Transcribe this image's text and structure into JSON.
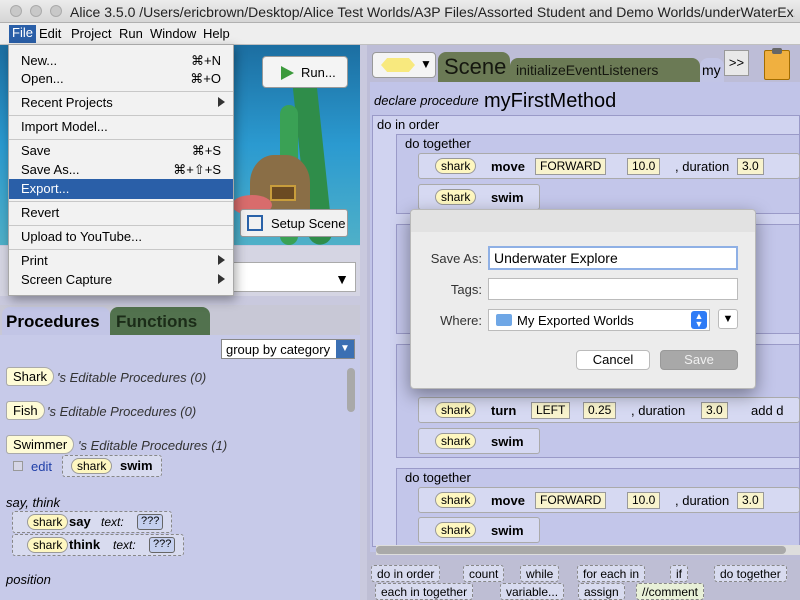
{
  "window": {
    "title": "Alice 3.5.0 /Users/ericbrown/Desktop/Alice Test Worlds/A3P Files/Assorted Student and Demo Worlds/underWaterEx..."
  },
  "menubar": {
    "items": [
      "File",
      "Edit",
      "Project",
      "Run",
      "Window",
      "Help"
    ]
  },
  "file_menu": {
    "items": [
      {
        "label": "New...",
        "shortcut": "⌘+N"
      },
      {
        "label": "Open...",
        "shortcut": "⌘+O"
      },
      {
        "label": "Recent Projects",
        "shortcut": ""
      },
      {
        "label": "Import Model...",
        "shortcut": ""
      },
      {
        "label": "Save",
        "shortcut": "⌘+S"
      },
      {
        "label": "Save As...",
        "shortcut": "⌘+⇧+S"
      },
      {
        "label": "Export...",
        "shortcut": ""
      },
      {
        "label": "Revert",
        "shortcut": ""
      },
      {
        "label": "Upload to YouTube...",
        "shortcut": ""
      },
      {
        "label": "Print",
        "shortcut": ""
      },
      {
        "label": "Screen Capture",
        "shortcut": ""
      }
    ],
    "selected": "Export..."
  },
  "scene": {
    "run_label": "Run...",
    "setup_label": "Setup Scene"
  },
  "left_tabs": {
    "procedures": "Procedures",
    "functions": "Functions"
  },
  "group_select": {
    "value": "group by category"
  },
  "procedures": {
    "shark_type": "Shark",
    "shark_title": "'s Editable Procedures (0)",
    "fish_type": "Fish",
    "fish_title": "'s Editable Procedures (0)",
    "swimmer_type": "Swimmer",
    "swimmer_title": "'s Editable Procedures (1)",
    "edit_label": "edit",
    "shark": "shark",
    "swim": "swim",
    "say_think": "say, think",
    "say": "say",
    "think": "think",
    "text": "text:",
    "qqq": "???",
    "position": "position"
  },
  "editor": {
    "tab_scene": "Scene",
    "tab_init": "initializeEventListeners",
    "tab_my": "my",
    "more": ">>",
    "declare": "declare procedure",
    "method": "myFirstMethod",
    "do_in_order": "do in order",
    "do_together": "do together",
    "move": "move",
    "swim": "swim",
    "turn": "turn",
    "forward": "FORWARD",
    "left": "LEFT",
    "ten": "10.0",
    "three": "3.0",
    "quarter": "0.25",
    "duration": ", duration",
    "add": "add d",
    "shark": "shark",
    "comma": ","
  },
  "palette": {
    "row1": [
      "do in order",
      "count",
      "while",
      "for each in",
      "if",
      "do together"
    ],
    "row2": [
      "each in  together",
      "variable...",
      "assign",
      "//comment"
    ]
  },
  "dialog": {
    "save_as_label": "Save As:",
    "save_as_value": "Underwater Explore",
    "tags_label": "Tags:",
    "where_label": "Where:",
    "where_value": "My Exported Worlds",
    "cancel": "Cancel",
    "save": "Save"
  }
}
